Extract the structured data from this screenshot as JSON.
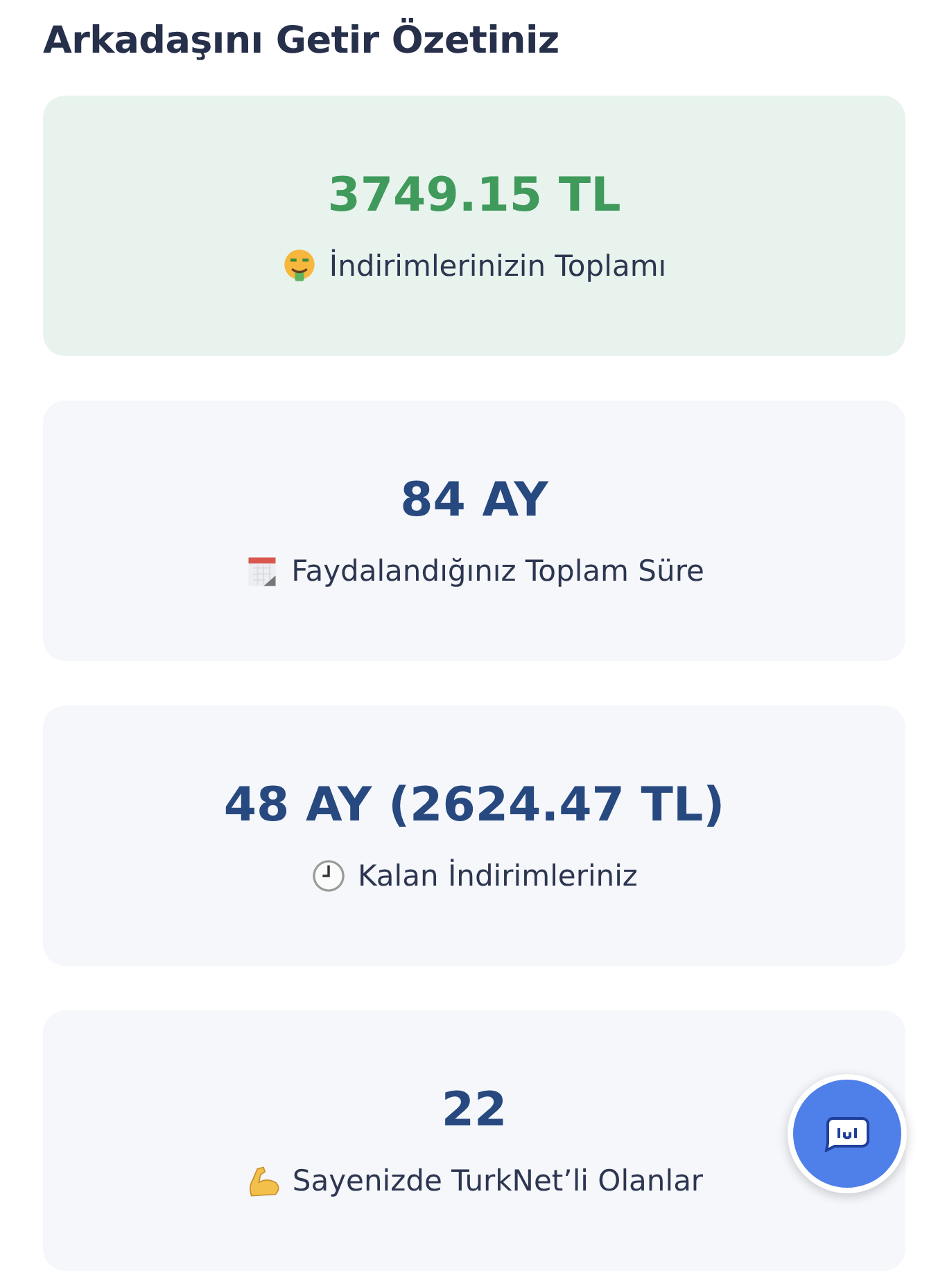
{
  "title": "Arkadaşını Getir Özetiniz",
  "cards": [
    {
      "kind": "highlight",
      "value": "3749.15 TL",
      "label": "İndirimlerinizin Toplamı"
    },
    {
      "kind": "plain",
      "value": "84 AY",
      "label": "Faydalandığınız Toplam Süre"
    },
    {
      "kind": "plain",
      "value": "48 AY (2624.47 TL)",
      "label": "Kalan İndirimleriniz"
    },
    {
      "kind": "plain",
      "value": "22",
      "label": "Sayenizde TurkNet’li Olanlar"
    }
  ]
}
